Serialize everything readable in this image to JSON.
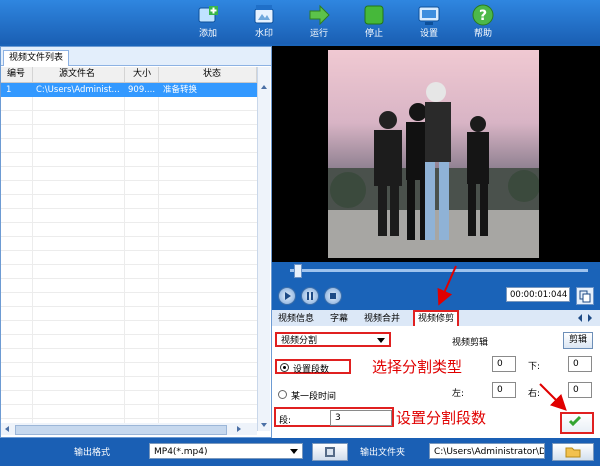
{
  "toolbar": {
    "add": "添加",
    "watermark": "水印",
    "run": "运行",
    "stop": "停止",
    "settings": "设置",
    "help": "帮助"
  },
  "file_list": {
    "tab_label": "视频文件列表",
    "columns": [
      "编号",
      "源文件名",
      "大小",
      "状态"
    ],
    "rows": [
      {
        "index": "1",
        "source": "C:\\Users\\Administ...",
        "size": "909....",
        "status": "准备转换"
      }
    ]
  },
  "player": {
    "time": "00:00:01:044"
  },
  "tabs": [
    "视频信息",
    "字幕",
    "视频合并",
    "视频修剪"
  ],
  "split": {
    "type_value": "视频分割",
    "option_segments": "设置段数",
    "option_time": "某一段时间",
    "segment_label": "段:",
    "segment_value": "3",
    "video_cut_label": "视频剪辑",
    "cut_button": "剪辑",
    "top_value": "0",
    "down_label": "下:",
    "down_value": "0",
    "left_label": "左:",
    "left_value": "0",
    "right_label": "右:",
    "right_value": "0"
  },
  "annotations": {
    "select_type": "选择分割类型",
    "set_segments": "设置分割段数"
  },
  "bottom": {
    "format_label": "输出格式",
    "format_value": "MP4(*.mp4)",
    "folder_label": "输出文件夹",
    "folder_value": "C:\\Users\\Administrator\\Des"
  },
  "colors": {
    "toolbar_blue": "#1a63b8",
    "annotation_red": "#e00000",
    "selection_blue": "#3399ff"
  }
}
